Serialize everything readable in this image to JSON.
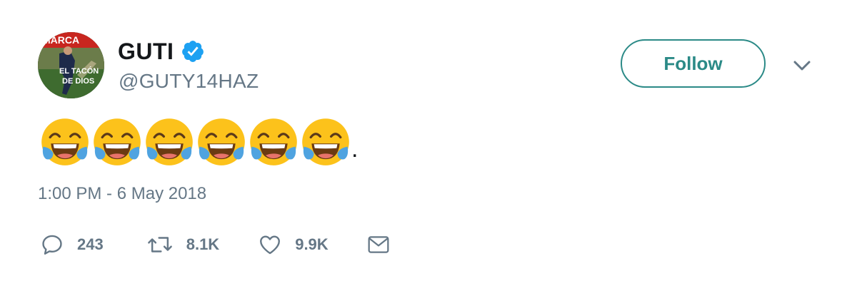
{
  "author": {
    "display_name": "GUTI",
    "handle": "@GUTY14HAZ",
    "verified": true,
    "avatar_text_top": "MARCA",
    "avatar_text_bottom": "EL TACÓN DE DIOS"
  },
  "follow_button": {
    "label": "Follow"
  },
  "tweet": {
    "emoji": [
      "face-with-tears-of-joy",
      "face-with-tears-of-joy",
      "face-with-tears-of-joy",
      "face-with-tears-of-joy",
      "face-with-tears-of-joy",
      "face-with-tears-of-joy"
    ],
    "trailing_text": ".",
    "timestamp": "1:00 PM - 6 May 2018"
  },
  "actions": {
    "replies": "243",
    "retweets": "8.1K",
    "likes": "9.9K"
  },
  "colors": {
    "accent": "#2b8a87",
    "verified": "#1da1f2",
    "muted": "#657786",
    "text": "#14171a",
    "emoji_face": "#fcc21b",
    "emoji_tear": "#4fa3e0"
  }
}
